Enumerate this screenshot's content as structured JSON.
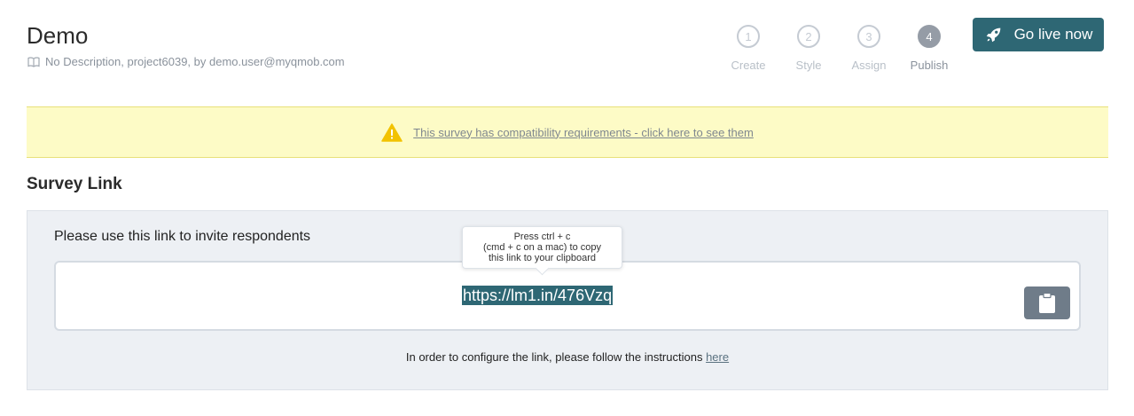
{
  "header": {
    "title": "Demo",
    "description": "No Description, project6039, by demo.user@myqmob.com",
    "description_icon": "book-icon"
  },
  "steps": [
    {
      "number": "1",
      "label": "Create",
      "active": false
    },
    {
      "number": "2",
      "label": "Style",
      "active": false
    },
    {
      "number": "3",
      "label": "Assign",
      "active": false
    },
    {
      "number": "4",
      "label": "Publish",
      "active": true
    }
  ],
  "go_live": {
    "label": "Go live now",
    "icon": "rocket-icon"
  },
  "warning": {
    "text": "This survey has compatibility requirements - click here to see them",
    "icon": "warning-triangle-icon"
  },
  "survey_link": {
    "section_title": "Survey Link",
    "invite_label": "Please use this link to invite respondents",
    "url": "https://lm1.in/476Vzq",
    "tooltip_lines": [
      "Press ctrl + c",
      "(cmd + c on a mac) to copy",
      "this link to your clipboard"
    ],
    "copy_icon": "clipboard-icon",
    "instructions_text": "In order to configure the link, please follow the instructions",
    "instructions_link": "here"
  },
  "colors": {
    "accent": "#2e6774",
    "warning_bg": "#fdfbc6",
    "warning_icon": "#f2c200",
    "panel_bg": "#edf0f4",
    "copy_button": "#6f7c89"
  }
}
